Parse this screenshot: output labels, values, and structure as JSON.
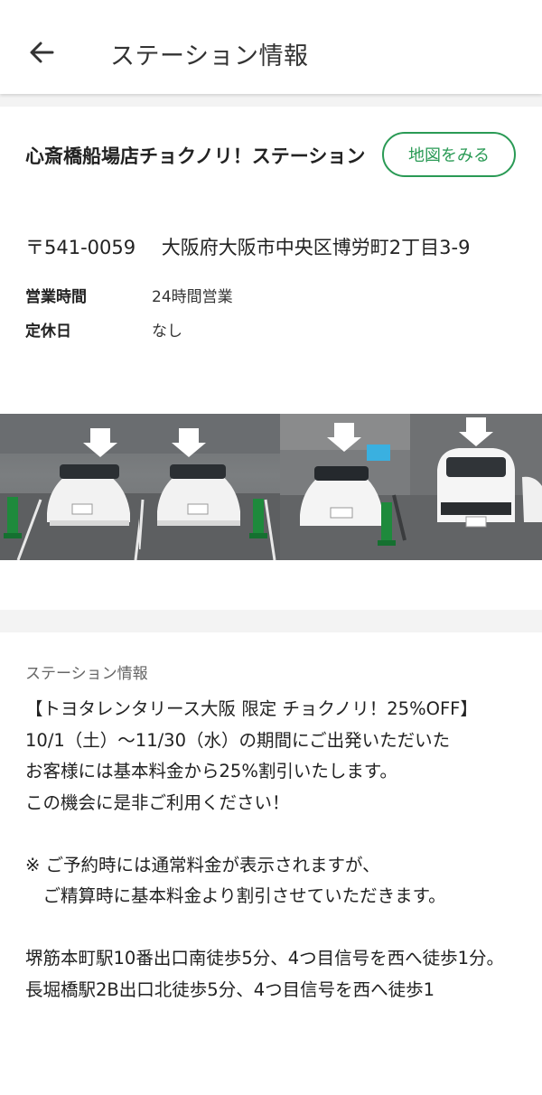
{
  "appbar": {
    "title": "ステーション情報",
    "back_icon": "arrow-left-icon"
  },
  "station": {
    "name": "心斎橋船場店チョクノリ！ステーション",
    "map_button_label": "地図をみる",
    "zip": "〒541-0059",
    "address": "大阪府大阪市中央区博労町2丁目3-9",
    "hours_label": "営業時間",
    "hours_value": "24時間営業",
    "holiday_label": "定休日",
    "holiday_value": "なし"
  },
  "photos": [
    {
      "name": "parking-photo-1",
      "car_color": "#f2f2f2"
    },
    {
      "name": "parking-photo-2",
      "car_color": "#f2f2f2"
    },
    {
      "name": "parking-photo-3",
      "car_color": "#f4f4f4"
    },
    {
      "name": "parking-photo-4",
      "car_color": "#f5f5f5"
    }
  ],
  "info": {
    "section_label": "ステーション情報",
    "lines": [
      "【トヨタレンタリース大阪 限定 チョクノリ！25%OFF】",
      "10/1（土）〜11/30（水）の期間にご出発いただいた",
      "お客様には基本料金から25%割引いたします。",
      "この機会に是非ご利用ください！",
      "",
      "※ ご予約時には通常料金が表示されますが、",
      "　ご精算時に基本料金より割引させていただきます。",
      "",
      "堺筋本町駅10番出口南徒歩5分、4つ目信号を西へ徒歩1分。",
      "長堀橋駅2B出口北徒歩5分、4つ目信号を西へ徒歩1"
    ]
  },
  "colors": {
    "accent_green": "#2a9a55",
    "background": "#f3f3f3"
  }
}
